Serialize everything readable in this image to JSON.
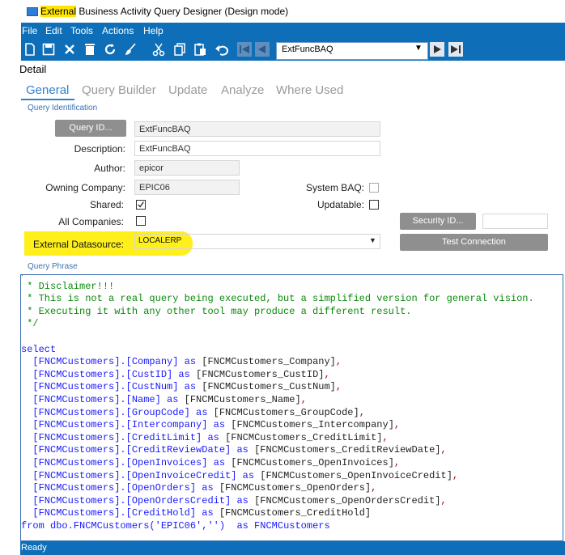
{
  "window": {
    "title_highlight": "External",
    "title_rest": " Business Activity Query Designer (Design mode)"
  },
  "menu": [
    "File",
    "Edit",
    "Tools",
    "Actions",
    "Help"
  ],
  "toolbar": {
    "icons": [
      "new-icon",
      "save-icon",
      "delete-icon",
      "clear-icon",
      "refresh-icon",
      "brush-icon",
      "cut-icon",
      "copy-icon",
      "paste-icon",
      "undo-icon",
      "first-record-icon",
      "previous-record-icon",
      "next-record-icon",
      "last-record-icon"
    ],
    "navigator_value": "ExtFuncBAQ"
  },
  "detail_label": "Detail",
  "tabs": [
    "General",
    "Query Builder",
    "Update",
    "Analyze",
    "Where Used"
  ],
  "active_tab": "General",
  "query_identification": {
    "section_label": "Query Identification",
    "query_id_button": "Query ID...",
    "query_id_value": "ExtFuncBAQ",
    "description_label": "Description:",
    "description_value": "ExtFuncBAQ",
    "author_label": "Author:",
    "author_value": "epicor",
    "owning_company_label": "Owning Company:",
    "owning_company_value": "EPIC06",
    "system_baq_label": "System BAQ:",
    "system_baq_checked": false,
    "shared_label": "Shared:",
    "shared_checked": true,
    "updatable_label": "Updatable:",
    "updatable_checked": false,
    "all_companies_label": "All Companies:",
    "all_companies_checked": false,
    "security_id_button": "Security ID...",
    "security_id_value": "",
    "external_datasource_label": "External Datasource:",
    "external_datasource_value": "LOCALERP",
    "test_connection_button": "Test Connection"
  },
  "query_phrase": {
    "section_label": "Query Phrase",
    "comment_lines": [
      "/*",
      " * Disclaimer!!!",
      " * This is not a real query being executed, but a simplified version for general vision.",
      " * Executing it with any other tool may produce a different result.",
      " */"
    ],
    "select_keyword": "select",
    "columns": [
      {
        "col": "[FNCMCustomers].[Company]",
        "alias": "[FNCMCustomers_Company]"
      },
      {
        "col": "[FNCMCustomers].[CustID]",
        "alias": "[FNCMCustomers_CustID]"
      },
      {
        "col": "[FNCMCustomers].[CustNum]",
        "alias": "[FNCMCustomers_CustNum]"
      },
      {
        "col": "[FNCMCustomers].[Name]",
        "alias": "[FNCMCustomers_Name]"
      },
      {
        "col": "[FNCMCustomers].[GroupCode]",
        "alias": "[FNCMCustomers_GroupCode]"
      },
      {
        "col": "[FNCMCustomers].[Intercompany]",
        "alias": "[FNCMCustomers_Intercompany]"
      },
      {
        "col": "[FNCMCustomers].[CreditLimit]",
        "alias": "[FNCMCustomers_CreditLimit]"
      },
      {
        "col": "[FNCMCustomers].[CreditReviewDate]",
        "alias": "[FNCMCustomers_CreditReviewDate]"
      },
      {
        "col": "[FNCMCustomers].[OpenInvoices]",
        "alias": "[FNCMCustomers_OpenInvoices]"
      },
      {
        "col": "[FNCMCustomers].[OpenInvoiceCredit]",
        "alias": "[FNCMCustomers_OpenInvoiceCredit]"
      },
      {
        "col": "[FNCMCustomers].[OpenOrders]",
        "alias": "[FNCMCustomers_OpenOrders]"
      },
      {
        "col": "[FNCMCustomers].[OpenOrdersCredit]",
        "alias": "[FNCMCustomers_OpenOrdersCredit]"
      },
      {
        "col": "[FNCMCustomers].[CreditHold]",
        "alias": "[FNCMCustomers_CreditHold]"
      }
    ],
    "from_line": "from dbo.FNCMCustomers('EPIC06','')",
    "from_alias": "as FNCMCustomers"
  },
  "status_text": "Ready",
  "colors": {
    "chrome_blue": "#0e6fb8",
    "highlight_yellow": "#ffef1a",
    "active_tab": "#2f7fd0"
  }
}
